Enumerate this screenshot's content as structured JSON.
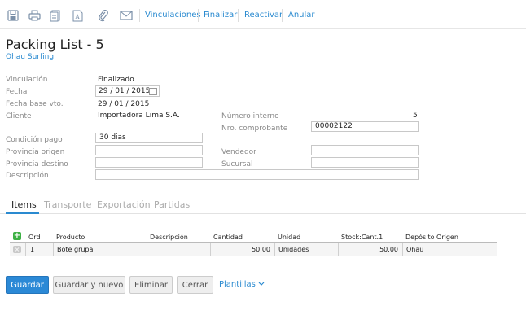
{
  "toolbar": {
    "icons": [
      "save-icon",
      "print-icon",
      "document-stack-icon",
      "text-document-icon",
      "attachment-icon",
      "email-icon"
    ],
    "links": [
      "Vinculaciones",
      "Finalizar",
      "Reactivar",
      "Anular"
    ]
  },
  "header": {
    "title": "Packing List - 5",
    "subtitle": "Ohau Surfing"
  },
  "form": {
    "vinculacion_label": "Vinculación",
    "vinculacion_value": "Finalizado",
    "fecha_label": "Fecha",
    "fecha_value": "29 / 01 / 2015",
    "fecha_base_label": "Fecha base vto.",
    "fecha_base_value": "29 / 01 / 2015",
    "cliente_label": "Cliente",
    "cliente_value": "Importadora Lima S.A.",
    "numero_interno_label": "Número interno",
    "numero_interno_value": "5",
    "nro_comprobante_label": "Nro. comprobante",
    "nro_comprobante_value": "00002122",
    "condicion_pago_label": "Condición pago",
    "condicion_pago_value": "30 dias",
    "provincia_origen_label": "Provincia origen",
    "provincia_origen_value": "",
    "vendedor_label": "Vendedor",
    "vendedor_value": "",
    "provincia_destino_label": "Provincia destino",
    "provincia_destino_value": "",
    "sucursal_label": "Sucursal",
    "sucursal_value": "",
    "descripcion_label": "Descripción",
    "descripcion_value": ""
  },
  "tabs": [
    "Items",
    "Transporte",
    "Exportación",
    "Partidas"
  ],
  "active_tab": "Items",
  "grid": {
    "columns": [
      "Ord",
      "Producto",
      "Descripción",
      "Cantidad",
      "Unidad",
      "Stock:Cant.1",
      "Depósito Origen"
    ],
    "rows": [
      [
        "1",
        "Bote grupal",
        "",
        "50.00",
        "Unidades",
        "50.00",
        "Ohau"
      ]
    ]
  },
  "actions": {
    "save": "Guardar",
    "save_new": "Guardar y nuevo",
    "delete": "Eliminar",
    "close": "Cerrar",
    "templates": "Plantillas"
  },
  "colors": {
    "accent": "#2a8ad0",
    "primary_button": "#2b89d6"
  }
}
